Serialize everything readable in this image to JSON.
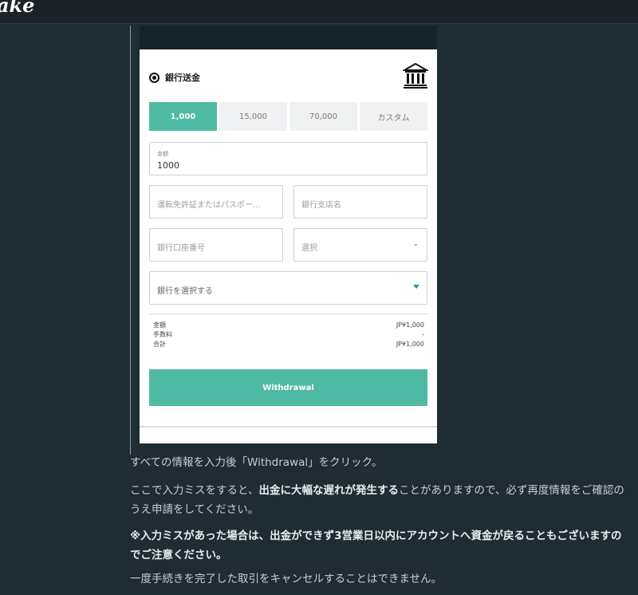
{
  "header": {
    "logo_text": "ake"
  },
  "phone": {
    "method": {
      "label": "銀行送金",
      "icon": "bank-icon"
    },
    "amount_options": [
      "1,000",
      "15,000",
      "70,000",
      "カスタム"
    ],
    "amount_field": {
      "label": "金額",
      "value": "1000"
    },
    "license_field": {
      "placeholder": "運転免許証またはパスポー..."
    },
    "branch_field": {
      "placeholder": "銀行支店名"
    },
    "account_field": {
      "placeholder": "銀行口座番号"
    },
    "select_field": {
      "placeholder": "選択"
    },
    "bank_field": {
      "placeholder": "銀行を選択する"
    },
    "summary": [
      {
        "label": "金額",
        "value": "JP¥1,000"
      },
      {
        "label": "手数料",
        "value": "-"
      },
      {
        "label": "合計",
        "value": "JP¥1,000"
      }
    ],
    "withdraw_label": "Withdrawal"
  },
  "article": {
    "p1": "すべての情報を入力後「Withdrawal」をクリック。",
    "p2_pre": "ここで入力ミスをすると、",
    "p2_bold": "出金に大幅な遅れが発生する",
    "p2_post": "ことがありますので、必ず再度情報をご確認のうえ申請をしてください。",
    "p3": "※入力ミスがあった場合は、出金ができず3営業日以内にアカウントへ資金が戻ることもございますのでご注意ください。",
    "p4": "一度手続きを完了した取引をキャンセルすることはできません。"
  },
  "colors": {
    "accent": "#4fbaa3",
    "background": "#1f2c33"
  }
}
